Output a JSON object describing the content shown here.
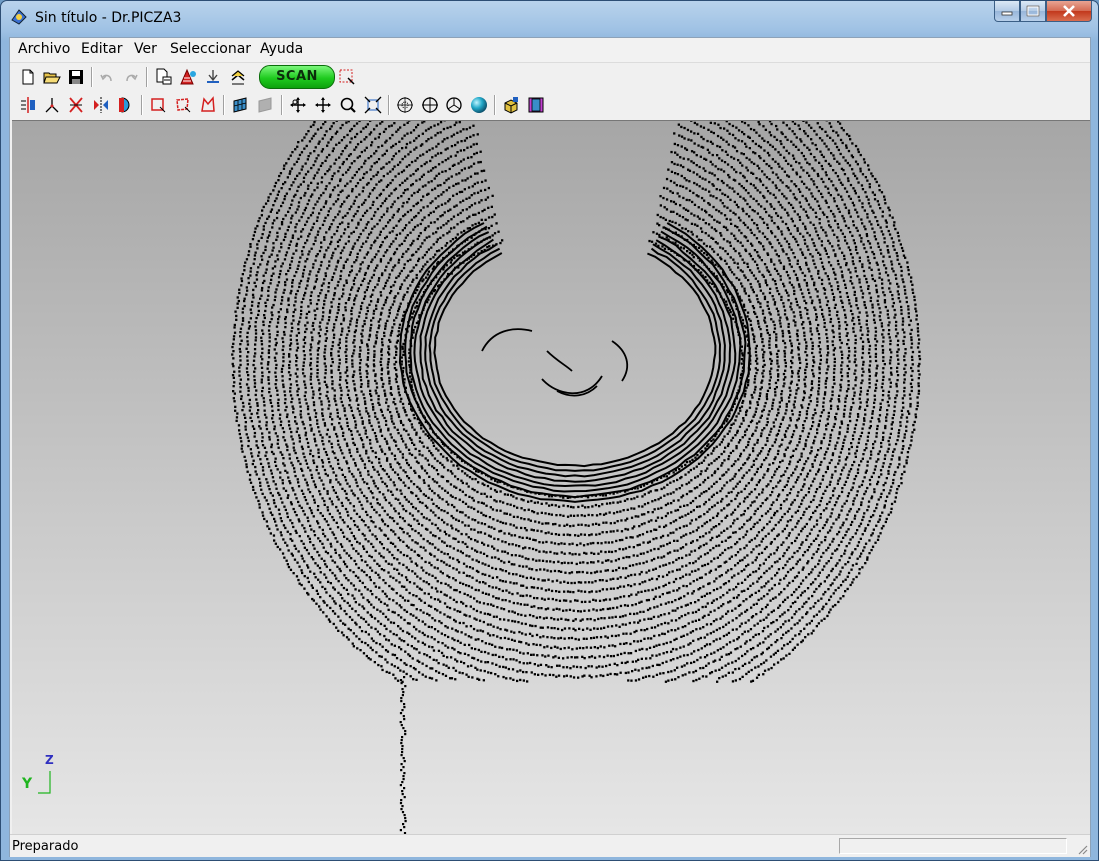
{
  "window": {
    "title": "Sin título - Dr.PICZA3"
  },
  "menu": {
    "items": [
      {
        "label": "Archivo"
      },
      {
        "label": "Editar"
      },
      {
        "label": "Ver"
      },
      {
        "label": "Seleccionar"
      },
      {
        "label": "Ayuda"
      }
    ]
  },
  "toolbar1": {
    "scan_label": "SCAN"
  },
  "viewport": {
    "axis_labels": {
      "y": "Y",
      "z": "Z"
    },
    "colors": {
      "points": "#000000",
      "bg_top": "#a6a6a6",
      "bg_bottom": "#e6e6e6",
      "y_axis": "#1fb51f",
      "z_axis": "#3030c0"
    }
  },
  "status": {
    "text": "Preparado"
  },
  "icons": {
    "toolbar1": [
      "new-file-icon",
      "open-folder-icon",
      "save-icon",
      "undo-icon",
      "redo-icon",
      "print-setup-icon",
      "color-mesh-icon",
      "scan-settings-icon",
      "triangle-stack-icon",
      "scan-button",
      "select-area-icon"
    ],
    "toolbar2": [
      "align-icon",
      "axis-icon",
      "mirror-icon",
      "flip-icon",
      "half-shape-icon",
      "select-rect-icon",
      "select-lasso-icon",
      "select-poly-icon",
      "shade-flat-icon",
      "shade-gray-icon",
      "rotate-icon",
      "pan-icon",
      "zoom-icon",
      "fit-view-icon",
      "view-front-icon",
      "view-top-icon",
      "view-side-icon",
      "sphere-render-icon",
      "cube-view-icon",
      "box-view-icon"
    ]
  }
}
